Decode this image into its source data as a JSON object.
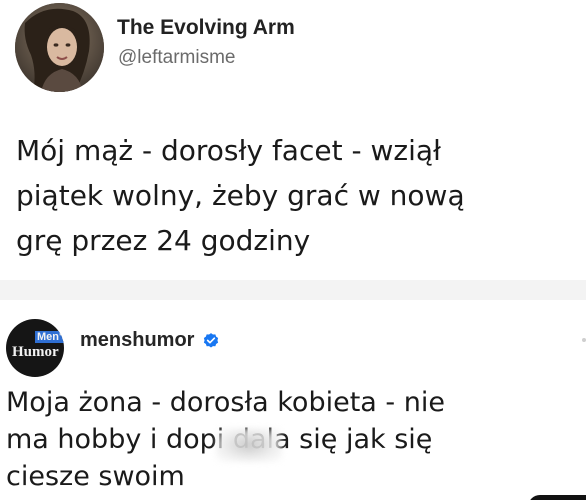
{
  "tweet": {
    "display_name": "The Evolving Arm",
    "handle": "@leftarmisme",
    "text_lines": [
      "Mój mąż - dorosły facet - wziął",
      "piątek wolny, żeby grać w nową",
      "grę przez 24 godziny"
    ],
    "avatar_icon": "profile-photo"
  },
  "comment": {
    "username": "menshumor",
    "verified_icon": "verified-badge-icon",
    "avatar_logo": {
      "top": "Men's",
      "bottom": "Humor"
    },
    "text_lines": [
      "Moja żona - dorosła kobieta - nie",
      "ma hobby i dopi     dala się jak się",
      "ciesze swoim"
    ],
    "colors": {
      "verified_blue": "#1877f2"
    }
  }
}
